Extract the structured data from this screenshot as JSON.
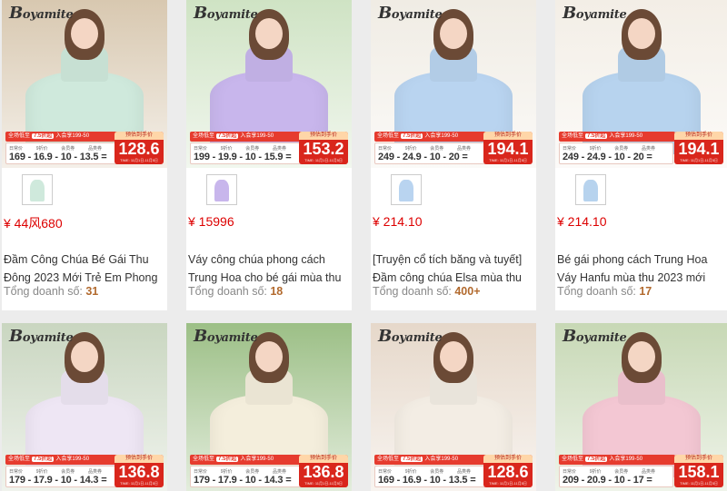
{
  "colors": {
    "price_red": "#dd0000",
    "banner_red": "#d9261c",
    "sales_orange": "#b26a2e"
  },
  "brand": "Boyamite",
  "products": [
    {
      "price": "¥ 44风680",
      "title": "Đầm Công Chúa Bé Gái Thu Đông 2023 Mới Trẻ Em Phong",
      "sales_label": "Tổng doanh số:",
      "sales_count": "31",
      "banner": {
        "promo": "全场低至",
        "discount": "7.5折起",
        "coupon": "入会享199-50",
        "calc": "169 - 16.9 - 10 - 13.5 =",
        "final": "128.6",
        "final_label": "预估到手价"
      },
      "dress_color": "#cfe9dc",
      "bg": "#d8c8b0"
    },
    {
      "price": "¥ 15996",
      "title": "Váy công chúa phong cách Trung Hoa cho bé gái mùa thu 2023",
      "sales_label": "Tổng doanh số:",
      "sales_count": "18",
      "banner": {
        "promo": "全场低至",
        "discount": "7.5折起",
        "coupon": "入会享199-50",
        "calc": "199 - 19.9 - 10 - 15.9 =",
        "final": "153.2",
        "final_label": "预估到手价"
      },
      "dress_color": "#c8b6ec",
      "bg": "#cfe3c4"
    },
    {
      "price": "¥ 214.10",
      "title": "[Truyện cổ tích băng và tuyết] Đầm công chúa Elsa mùa thu",
      "sales_label": "Tổng doanh số:",
      "sales_count": "400+",
      "banner": {
        "promo": "全场低至",
        "discount": "7.5折起",
        "coupon": "入会享199-50",
        "calc": "249 - 24.9 - 10 - 20 =",
        "final": "194.1",
        "final_label": "预估到手价"
      },
      "dress_color": "#b9d4f0",
      "bg": "#f0ece4"
    },
    {
      "price": "¥ 214.10",
      "title": "Bé gái phong cách Trung Hoa Váy Hanfu mùa thu 2023 mới phong",
      "sales_label": "Tổng doanh số:",
      "sales_count": "17",
      "banner": {
        "promo": "全场低至",
        "discount": "7.5折起",
        "coupon": "入会享199-50",
        "calc": "249 - 24.9 - 10 - 20 =",
        "final": "194.1",
        "final_label": "预估到手价"
      },
      "dress_color": "#b7d3ee",
      "bg": "#f3eee6"
    },
    {
      "banner": {
        "promo": "全场低至",
        "discount": "7.5折起",
        "coupon": "入会享199-50",
        "calc": "179 - 17.9 - 10 - 14.3 =",
        "final": "136.8",
        "final_label": "预估到手价"
      },
      "dress_color": "#eee6f4",
      "bg": "#c9d6c0"
    },
    {
      "banner": {
        "promo": "全场低至",
        "discount": "7.5折起",
        "coupon": "入会享199-50",
        "calc": "179 - 17.9 - 10 - 14.3 =",
        "final": "136.8",
        "final_label": "预估到手价"
      },
      "dress_color": "#f4eedc",
      "bg": "#9cbf86"
    },
    {
      "banner": {
        "promo": "全场低至",
        "discount": "7.5折起",
        "coupon": "入会享199-50",
        "calc": "169 - 16.9 - 10 - 13.5 =",
        "final": "128.6",
        "final_label": "预估到手价"
      },
      "dress_color": "#f3ede4",
      "bg": "#e6d8ca"
    },
    {
      "banner": {
        "promo": "全场低至",
        "discount": "7.5折起",
        "coupon": "入会享199-50",
        "calc": "209 - 20.9 - 10 - 17 =",
        "final": "158.1",
        "final_label": "预估到手价"
      },
      "dress_color": "#f3c7d3",
      "bg": "#c7d8b5"
    }
  ]
}
